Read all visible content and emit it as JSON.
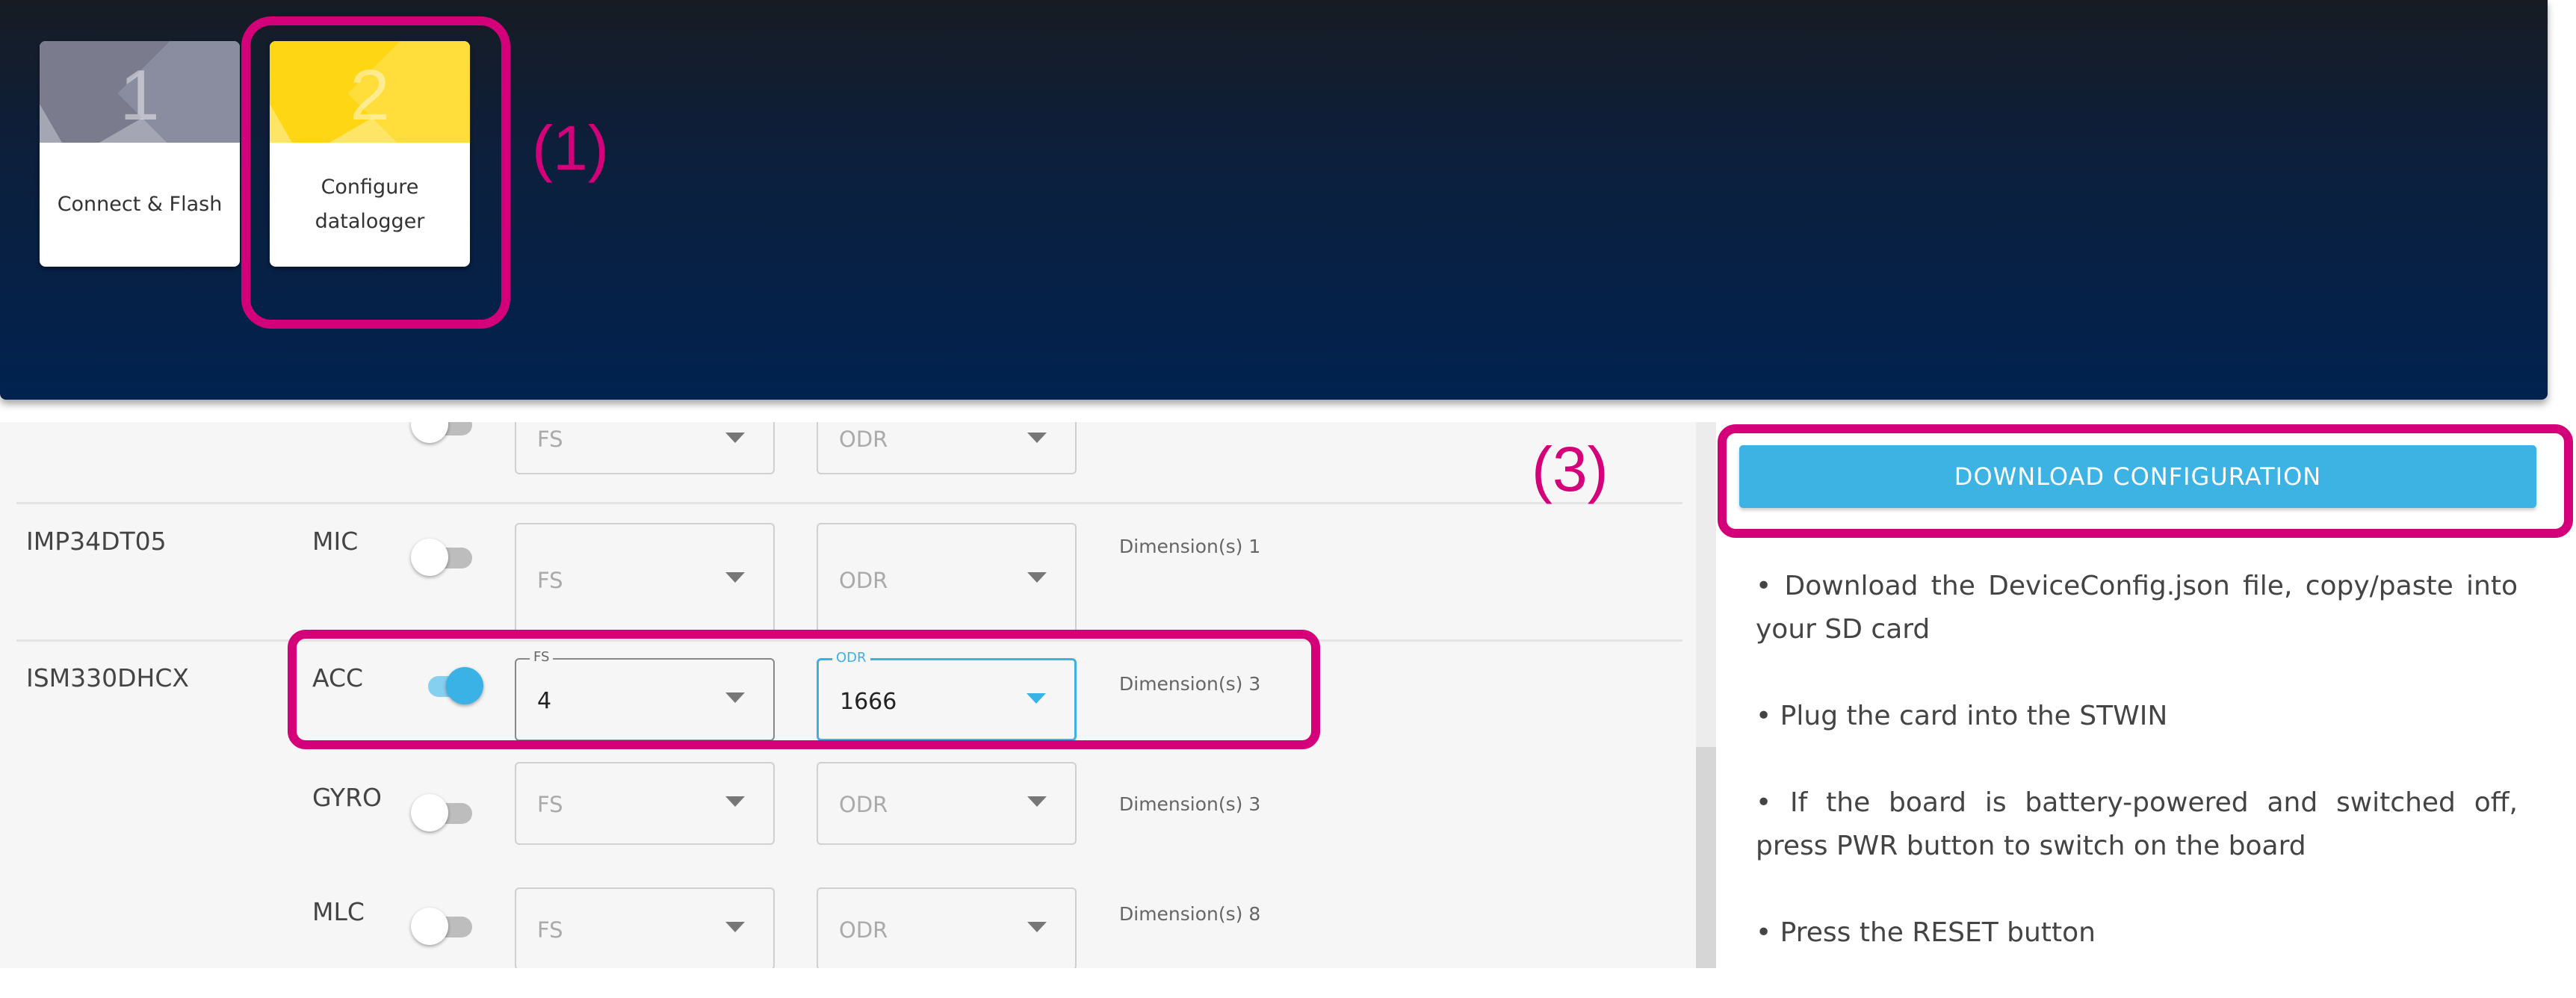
{
  "steps": [
    {
      "number": "1",
      "label": "Connect & Flash",
      "state": "done"
    },
    {
      "number": "2",
      "label": "Configure datalogger",
      "state": "active"
    }
  ],
  "annotations": {
    "a1": "(1)",
    "a3": "(3)"
  },
  "colors": {
    "accent": "#3db3e3",
    "highlight": "#d4007a",
    "active_step": "#ffd614"
  },
  "sensors": [
    {
      "name": "",
      "components": [
        {
          "name": "",
          "enabled": false,
          "fs": {
            "placeholder": "FS",
            "value": ""
          },
          "odr": {
            "placeholder": "ODR",
            "value": ""
          },
          "dimensions": ""
        }
      ]
    },
    {
      "name": "IMP34DT05",
      "components": [
        {
          "name": "MIC",
          "enabled": false,
          "fs": {
            "placeholder": "FS",
            "value": ""
          },
          "odr": {
            "placeholder": "ODR",
            "value": ""
          },
          "dimensions": "Dimension(s) 1"
        }
      ]
    },
    {
      "name": "ISM330DHCX",
      "components": [
        {
          "name": "ACC",
          "enabled": true,
          "fs": {
            "label": "FS",
            "value": "4"
          },
          "odr": {
            "label": "ODR",
            "value": "1666"
          },
          "dimensions": "Dimension(s) 3"
        },
        {
          "name": "GYRO",
          "enabled": false,
          "fs": {
            "placeholder": "FS",
            "value": ""
          },
          "odr": {
            "placeholder": "ODR",
            "value": ""
          },
          "dimensions": "Dimension(s) 3"
        },
        {
          "name": "MLC",
          "enabled": false,
          "fs": {
            "placeholder": "FS",
            "value": ""
          },
          "odr": {
            "placeholder": "ODR",
            "value": ""
          },
          "dimensions": "Dimension(s) 8"
        }
      ]
    }
  ],
  "download_label": "DOWNLOAD CONFIGURATION",
  "instructions": [
    "• Download the DeviceConfig.json file, copy/paste into your SD card",
    "• Plug the card into the STWIN",
    "• If the board is battery-powered and switched off, press PWR button to switch on the board",
    "• Press the RESET button"
  ]
}
